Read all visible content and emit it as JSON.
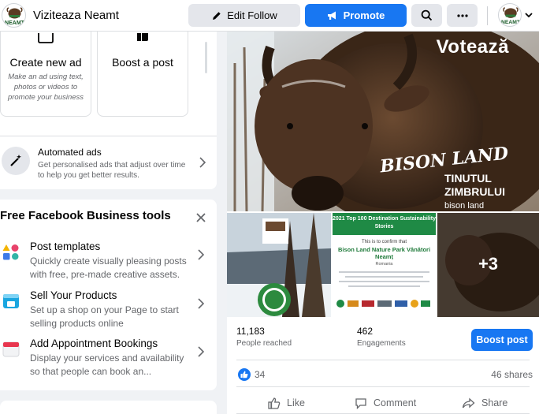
{
  "header": {
    "page_name": "Viziteaza Neamt",
    "edit_follow_label": "Edit Follow",
    "promote_label": "Promote",
    "logo_text": "NEAMT"
  },
  "colors": {
    "brand_blue": "#1877f2",
    "panel_bg": "#ffffff",
    "page_bg": "#f0f2f5",
    "secondary_text": "#65676b"
  },
  "ad_tiles": [
    {
      "title": "Create new ad",
      "description": "Make an ad using text, photos or videos to promote your business",
      "icon": "image-icon"
    },
    {
      "title": "Boost a post",
      "icon": "thumbs-up-icon"
    }
  ],
  "automated_ads": {
    "title": "Automated ads",
    "description": "Get personalised ads that adjust over time to help you get better results.",
    "icon": "magic-wand-icon"
  },
  "tools": {
    "title": "Free Facebook Business tools",
    "items": [
      {
        "title": "Post templates",
        "description": "Quickly create visually pleasing posts with free, pre-made creative assets.",
        "icon": "shapes-icon"
      },
      {
        "title": "Sell Your Products",
        "description": "Set up a shop on your Page to start selling products online",
        "icon": "shop-icon"
      },
      {
        "title": "Add Appointment Bookings",
        "description": "Display your services and availability so that people can book an...",
        "icon": "calendar-icon"
      }
    ]
  },
  "post": {
    "hero_title": "Votează",
    "brand_logo": "BISON LAND",
    "brand_name": "TINUTUL ZIMBRULUI",
    "brand_tagline": "bison land",
    "certificate": {
      "header": "2021 Top 100 Destination Sustainability Stories",
      "intro": "This is to confirm that",
      "name": "Bison Land Nature Park Vânători Neamț",
      "country": "Romania"
    },
    "more_photos": "+3",
    "people_reached": "11,183",
    "people_reached_label": "People reached",
    "engagements": "462",
    "engagements_label": "Engagements",
    "boost_label": "Boost post",
    "reactions_count": "34",
    "shares": "46 shares",
    "actions": {
      "like": "Like",
      "comment": "Comment",
      "share": "Share"
    }
  }
}
